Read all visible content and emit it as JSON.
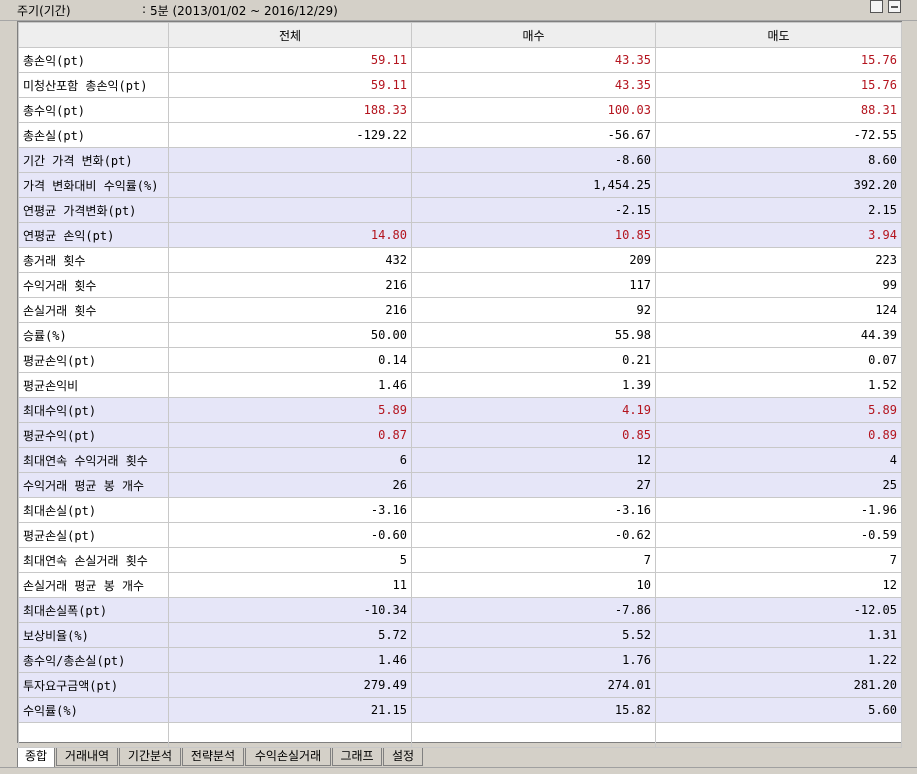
{
  "header": {
    "period_label": "주기(기간)",
    "separator": ":",
    "period_value": "5분 (2013/01/02 ~ 2016/12/29)"
  },
  "table": {
    "columns": [
      "",
      "전체",
      "매수",
      "매도"
    ],
    "rows": [
      {
        "label": "총손익(pt)",
        "values": [
          "59.11",
          "43.35",
          "15.76"
        ],
        "hl": false,
        "red": true
      },
      {
        "label": "미청산포함 총손익(pt)",
        "values": [
          "59.11",
          "43.35",
          "15.76"
        ],
        "hl": false,
        "red": true
      },
      {
        "label": "총수익(pt)",
        "values": [
          "188.33",
          "100.03",
          "88.31"
        ],
        "hl": false,
        "red": true
      },
      {
        "label": "총손실(pt)",
        "values": [
          "-129.22",
          "-56.67",
          "-72.55"
        ],
        "hl": false,
        "red": false
      },
      {
        "label": "기간 가격 변화(pt)",
        "values": [
          "",
          "-8.60",
          "8.60"
        ],
        "hl": true,
        "red": false
      },
      {
        "label": "가격 변화대비 수익률(%)",
        "values": [
          "",
          "1,454.25",
          "392.20"
        ],
        "hl": true,
        "red": false
      },
      {
        "label": "연평균 가격변화(pt)",
        "values": [
          "",
          "-2.15",
          "2.15"
        ],
        "hl": true,
        "red": false
      },
      {
        "label": "연평균 손익(pt)",
        "values": [
          "14.80",
          "10.85",
          "3.94"
        ],
        "hl": true,
        "red": true
      },
      {
        "label": "총거래 횟수",
        "values": [
          "432",
          "209",
          "223"
        ],
        "hl": false,
        "red": false
      },
      {
        "label": "수익거래 횟수",
        "values": [
          "216",
          "117",
          "99"
        ],
        "hl": false,
        "red": false
      },
      {
        "label": "손실거래 횟수",
        "values": [
          "216",
          "92",
          "124"
        ],
        "hl": false,
        "red": false
      },
      {
        "label": "승률(%)",
        "values": [
          "50.00",
          "55.98",
          "44.39"
        ],
        "hl": false,
        "red": false
      },
      {
        "label": "평균손익(pt)",
        "values": [
          "0.14",
          "0.21",
          "0.07"
        ],
        "hl": false,
        "red": false
      },
      {
        "label": "평균손익비",
        "values": [
          "1.46",
          "1.39",
          "1.52"
        ],
        "hl": false,
        "red": false
      },
      {
        "label": "최대수익(pt)",
        "values": [
          "5.89",
          "4.19",
          "5.89"
        ],
        "hl": true,
        "red": true
      },
      {
        "label": "평균수익(pt)",
        "values": [
          "0.87",
          "0.85",
          "0.89"
        ],
        "hl": true,
        "red": true
      },
      {
        "label": "최대연속 수익거래 횟수",
        "values": [
          "6",
          "12",
          "4"
        ],
        "hl": true,
        "red": false
      },
      {
        "label": "수익거래 평균 봉 개수",
        "values": [
          "26",
          "27",
          "25"
        ],
        "hl": true,
        "red": false
      },
      {
        "label": "최대손실(pt)",
        "values": [
          "-3.16",
          "-3.16",
          "-1.96"
        ],
        "hl": false,
        "red": false
      },
      {
        "label": "평균손실(pt)",
        "values": [
          "-0.60",
          "-0.62",
          "-0.59"
        ],
        "hl": false,
        "red": false
      },
      {
        "label": "최대연속 손실거래 횟수",
        "values": [
          "5",
          "7",
          "7"
        ],
        "hl": false,
        "red": false
      },
      {
        "label": "손실거래 평균 봉 개수",
        "values": [
          "11",
          "10",
          "12"
        ],
        "hl": false,
        "red": false
      },
      {
        "label": "최대손실폭(pt)",
        "values": [
          "-10.34",
          "-7.86",
          "-12.05"
        ],
        "hl": true,
        "red": false
      },
      {
        "label": "보상비율(%)",
        "values": [
          "5.72",
          "5.52",
          "1.31"
        ],
        "hl": true,
        "red": false
      },
      {
        "label": "총수익/총손실(pt)",
        "values": [
          "1.46",
          "1.76",
          "1.22"
        ],
        "hl": true,
        "red": false
      },
      {
        "label": "투자요구금액(pt)",
        "values": [
          "279.49",
          "274.01",
          "281.20"
        ],
        "hl": true,
        "red": false
      },
      {
        "label": "수익률(%)",
        "values": [
          "21.15",
          "15.82",
          "5.60"
        ],
        "hl": true,
        "red": false
      }
    ]
  },
  "tabs": [
    "종합",
    "거래내역",
    "기간분석",
    "전략분석",
    "수익손실거래",
    "그래프",
    "설정"
  ],
  "active_tab": 0,
  "colors": {
    "highlight_row": "#e6e6f8",
    "positive_red": "#b4141e"
  }
}
